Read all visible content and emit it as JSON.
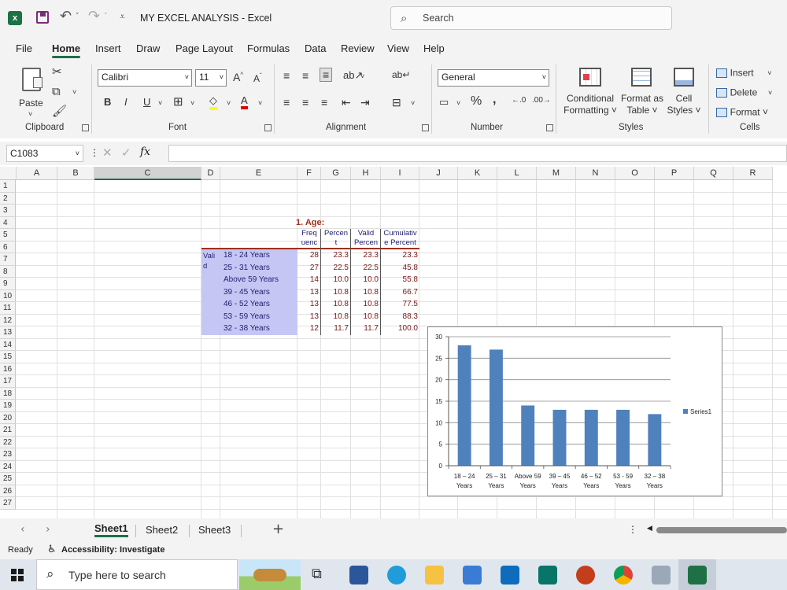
{
  "titlebar": {
    "title": "MY EXCEL ANALYSIS  -  Excel",
    "search_placeholder": "Search"
  },
  "tabs": [
    "File",
    "Home",
    "Insert",
    "Draw",
    "Page Layout",
    "Formulas",
    "Data",
    "Review",
    "View",
    "Help"
  ],
  "ribbon": {
    "paste": "Paste",
    "font_name": "Calibri",
    "font_size": "11",
    "number_format": "General",
    "conditional_formatting": [
      "Conditional",
      "Formatting ˅"
    ],
    "format_as_table": [
      "Format as",
      "Table ˅"
    ],
    "cell_styles": [
      "Cell",
      "Styles ˅"
    ],
    "insert": "Insert",
    "delete": "Delete",
    "format": "Format ˅",
    "groups": {
      "clipboard": "Clipboard",
      "font": "Font",
      "alignment": "Alignment",
      "number": "Number",
      "styles": "Styles",
      "cells": "Cells"
    }
  },
  "formula_bar": {
    "name_box": "C1083",
    "fx": "fx"
  },
  "grid": {
    "columns": [
      "A",
      "B",
      "C",
      "D",
      "E",
      "F",
      "G",
      "H",
      "I",
      "J",
      "K",
      "L",
      "M",
      "N",
      "O",
      "P",
      "Q",
      "R"
    ],
    "rows": [
      "1",
      "2",
      "3",
      "4",
      "5",
      "6",
      "7",
      "8",
      "9",
      "10",
      "11",
      "12",
      "13",
      "14",
      "15",
      "16",
      "17",
      "18",
      "19",
      "20",
      "21",
      "22",
      "23",
      "24",
      "25",
      "26",
      "27"
    ]
  },
  "table": {
    "title": "1. Age:",
    "headers": [
      [
        "Freq",
        "uenc"
      ],
      [
        "Percen",
        "t"
      ],
      [
        "Valid",
        "Percen"
      ],
      [
        "Cumulativ",
        "e Percent"
      ]
    ],
    "valid_label": [
      "Vali",
      "d"
    ],
    "rows": [
      {
        "label": "18 - 24 Years",
        "freq": "28",
        "pct": "23.3",
        "valid": "23.3",
        "cum": "23.3"
      },
      {
        "label": "25 - 31 Years",
        "freq": "27",
        "pct": "22.5",
        "valid": "22.5",
        "cum": "45.8"
      },
      {
        "label": "Above 59 Years",
        "freq": "14",
        "pct": "10.0",
        "valid": "10.0",
        "cum": "55.8"
      },
      {
        "label": "39 - 45 Years",
        "freq": "13",
        "pct": "10.8",
        "valid": "10.8",
        "cum": "66.7"
      },
      {
        "label": "46 - 52 Years",
        "freq": "13",
        "pct": "10.8",
        "valid": "10.8",
        "cum": "77.5"
      },
      {
        "label": "53 - 59 Years",
        "freq": "13",
        "pct": "10.8",
        "valid": "10.8",
        "cum": "88.3"
      },
      {
        "label": "32 - 38 Years",
        "freq": "12",
        "pct": "11.7",
        "valid": "11.7",
        "cum": "100.0"
      }
    ]
  },
  "chart_data": {
    "type": "bar",
    "categories": [
      [
        "18 – 24",
        "Years"
      ],
      [
        "25 – 31",
        "Years"
      ],
      [
        "Above 59",
        "Years"
      ],
      [
        "39 – 45",
        "Years"
      ],
      [
        "46 – 52",
        "Years"
      ],
      [
        "53 - 59",
        "Years"
      ],
      [
        "32 – 38",
        "Years"
      ]
    ],
    "series": [
      {
        "name": "Series1",
        "values": [
          28,
          27,
          14,
          13,
          13,
          13,
          12
        ],
        "color": "#4f81bd"
      }
    ],
    "yticks": [
      "0",
      "5",
      "10",
      "15",
      "20",
      "25",
      "30"
    ],
    "ylim": [
      0,
      30
    ],
    "grid": true,
    "legend_position": "right"
  },
  "sheet_tabs": [
    "Sheet1",
    "Sheet2",
    "Sheet3"
  ],
  "status": {
    "ready": "Ready",
    "accessibility": "Accessibility: Investigate"
  },
  "taskbar": {
    "search_placeholder": "Type here to search"
  },
  "colors": {
    "accent": "#1e7145",
    "selection": "#c6c6f5",
    "chart_bar": "#4f81bd",
    "table_title": "#a0301a"
  }
}
